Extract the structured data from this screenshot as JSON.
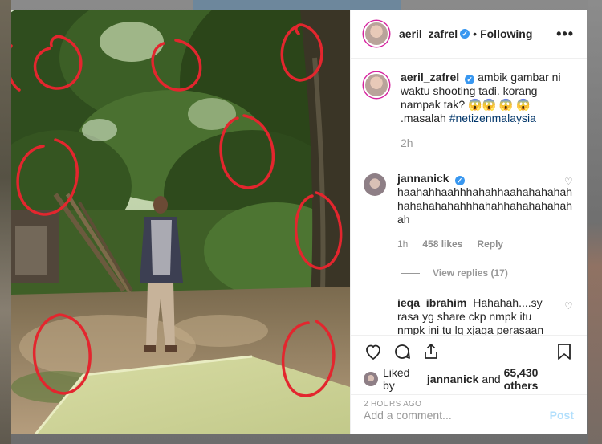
{
  "post": {
    "author": "aeril_zafrel",
    "follow_label": "Following",
    "more_label": "•••",
    "caption_text": "ambik gambar ni waktu shooting tadi. korang nampak tak? 😱😱 😱 😱 .masalah",
    "caption_hashtag": "#netizenmalaysia",
    "caption_time": "2h",
    "likes_prefix": "Liked by",
    "likes_user": "jannanick",
    "likes_and": "and",
    "likes_count": "65,430 others",
    "timestamp": "2 HOURS AGO"
  },
  "comments": [
    {
      "user": "jannanick",
      "text": "haahahhaahhhahahhaahahahahah hahahahahahhhahahhahahahahah ah",
      "time": "1h",
      "likes": "458 likes",
      "reply_label": "Reply",
      "view_replies": "View replies (17)"
    },
    {
      "user": "ieqa_ibrahim",
      "text": "Hahahah....sy rasa yg share ckp nmpk itu nmpk ini tu lg xjaga perasaan family mangsa....pembiasan cahaya pon diaorg ckp mcm rupa makhluk halus......bkn xpercaya pd org yg"
    }
  ],
  "add_comment": {
    "placeholder": "Add a comment...",
    "post_label": "Post"
  },
  "icons": [
    "heart-icon",
    "comment-icon",
    "share-icon",
    "bookmark-icon",
    "verified-badge-icon",
    "more-options-icon"
  ],
  "colors": {
    "link": "#003569",
    "verified": "#3897f0",
    "post_disabled": "#b2dffc",
    "muted": "#8e8e8e",
    "circle_annotation": "#e3262e"
  }
}
